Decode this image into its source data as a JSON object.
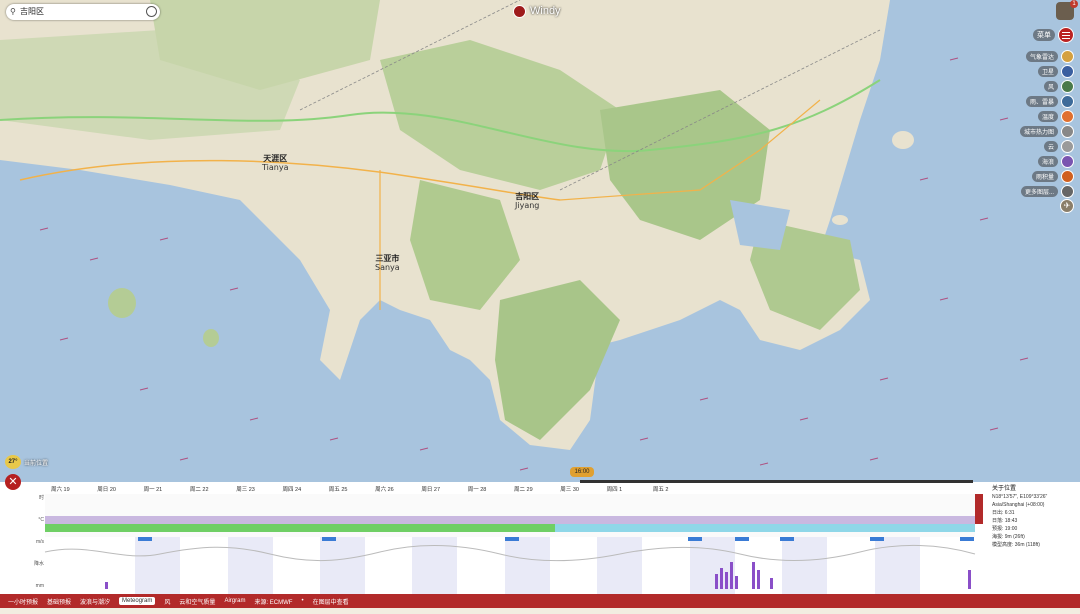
{
  "search": {
    "value": "吉阳区"
  },
  "app": {
    "name": "Windy"
  },
  "right_panel": {
    "badge": "1",
    "menu_label": "菜单",
    "layers": [
      {
        "label": "气象雷达",
        "color": "#d4a040"
      },
      {
        "label": "卫星",
        "color": "#3a5fa0"
      },
      {
        "label": "风",
        "color": "#4a7a4a"
      },
      {
        "label": "雨、雷暴",
        "color": "#3d6b9a"
      },
      {
        "label": "温度",
        "color": "#e07030"
      },
      {
        "label": "城市热力图",
        "color": "#888888"
      },
      {
        "label": "云",
        "color": "#9a9a9a"
      },
      {
        "label": "海浪",
        "color": "#7a55b0"
      },
      {
        "label": "雨积量",
        "color": "#d06020"
      },
      {
        "label": "更多图层...",
        "color": "#666666"
      }
    ]
  },
  "map_labels": [
    {
      "cn": "天涯区",
      "en": "Tianya"
    },
    {
      "cn": "吉阳区",
      "en": "Jiyang"
    },
    {
      "cn": "三亚市",
      "en": "Sanya"
    }
  ],
  "map_overlay": {
    "temperature": "27°",
    "temp_note": "当前位置",
    "time": "16:00"
  },
  "meteogram": {
    "days": [
      "周六 19",
      "周日 20",
      "周一 21",
      "周二 22",
      "周三 23",
      "周四 24",
      "周五 25",
      "周六 26",
      "周日 27",
      "周一 28",
      "周二 29",
      "周三 30",
      "周四 1",
      "周五 2"
    ],
    "row_labels": [
      "时",
      "",
      "°C",
      "",
      "m/s",
      "",
      "降水",
      "",
      "mm",
      "",
      ""
    ],
    "side": {
      "title": "关于位置",
      "lines": [
        "N18°13'57\", E109°33'26\"",
        "Asia/Shanghai (+08:00)",
        "日出: 6:31",
        "日落: 18:43",
        "预报: 19:00",
        "海拔: 9m (26ft)",
        "模型高度: 36m (118ft)"
      ]
    }
  },
  "bottom_bar": {
    "items": [
      "一小时预报",
      "基础预报",
      "波浪与潮汐",
      "Meteogram",
      "风",
      "云和空气质量",
      "Airgram",
      "来源: ECMWF",
      "•",
      "在图层中查看"
    ],
    "active_index": 3
  }
}
